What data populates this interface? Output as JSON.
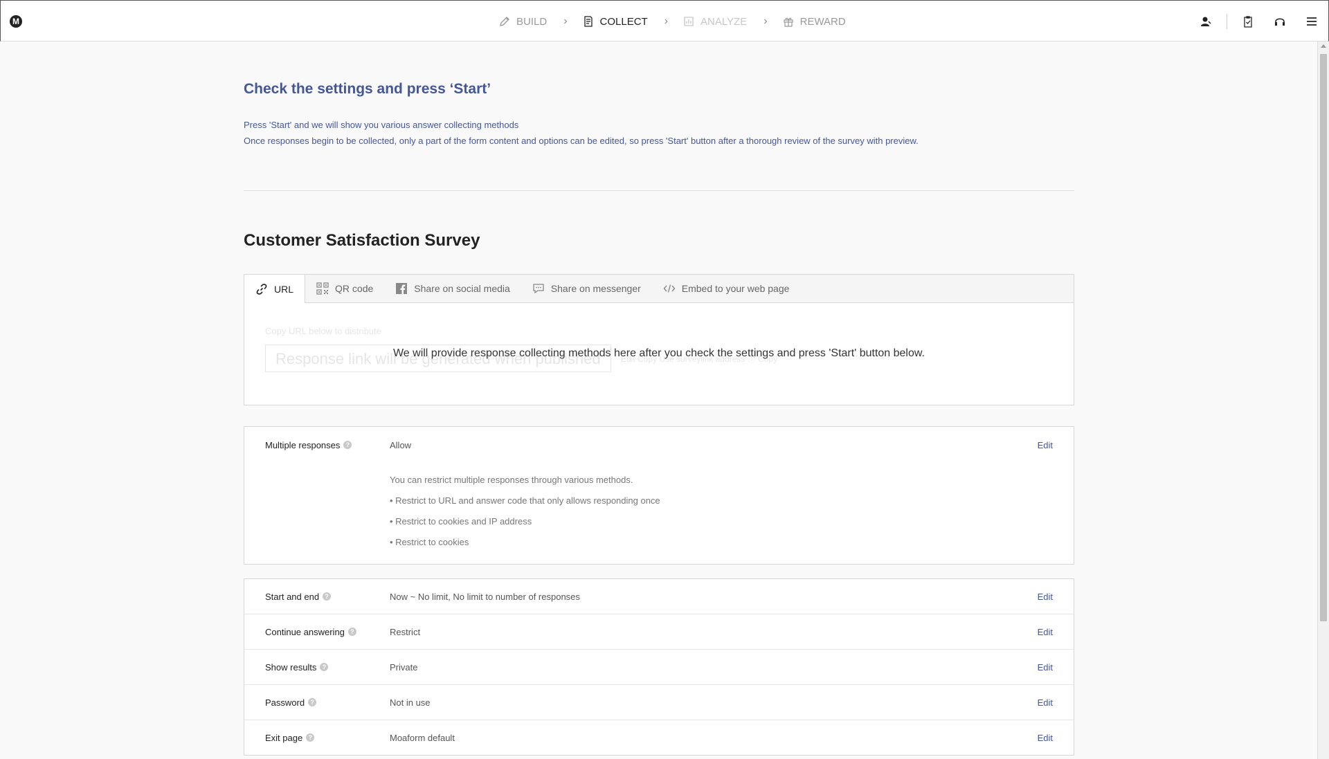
{
  "header": {
    "logo_letter": "M",
    "steps": [
      {
        "label": "BUILD",
        "state": "done"
      },
      {
        "label": "COLLECT",
        "state": "active"
      },
      {
        "label": "ANALYZE",
        "state": "disabled"
      },
      {
        "label": "REWARD",
        "state": "done"
      }
    ],
    "step_separator": "›"
  },
  "page": {
    "heading": "Check the settings and press ‘Start’",
    "desc_line1": "Press 'Start' and we will show you various answer collecting methods",
    "desc_line2": "Once responses begin to be collected, only a part of the form content and options can be edited, so press 'Start' button after a thorough review of the survey with preview.",
    "survey_title": "Customer Satisfaction Survey"
  },
  "tabs": [
    {
      "label": "URL",
      "icon": "link-icon"
    },
    {
      "label": "QR code",
      "icon": "qr-code-icon"
    },
    {
      "label": "Share on social media",
      "icon": "facebook-icon"
    },
    {
      "label": "Share on messenger",
      "icon": "message-icon"
    },
    {
      "label": "Embed to your web page",
      "icon": "code-icon"
    }
  ],
  "tab_body": {
    "ghost_label": "Copy URL below to distribute",
    "ghost_input": "Response link will be generated when published",
    "ghost_links": "Edit  Copy    Use surveylink address  ⓘ  Copy",
    "message": "We will provide response collecting methods here after you check the settings and press 'Start' button below."
  },
  "multiple_responses": {
    "label": "Multiple responses",
    "value": "Allow",
    "edit": "Edit",
    "notes": [
      "You can restrict multiple responses through various methods.",
      "• Restrict to URL and answer code that only allows responding once",
      "• Restrict to cookies and IP address",
      "• Restrict to cookies"
    ]
  },
  "settings": [
    {
      "label": "Start and end",
      "value": "Now ~ No limit, No limit to number of responses",
      "edit": "Edit"
    },
    {
      "label": "Continue answering",
      "value": "Restrict",
      "edit": "Edit"
    },
    {
      "label": "Show results",
      "value": "Private",
      "edit": "Edit"
    },
    {
      "label": "Password",
      "value": "Not in use",
      "edit": "Edit"
    },
    {
      "label": "Exit page",
      "value": "Moaform default",
      "edit": "Edit"
    }
  ],
  "help_glyph": "?"
}
